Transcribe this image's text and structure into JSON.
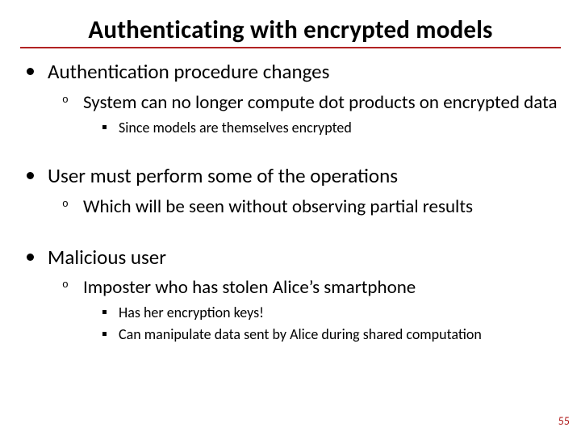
{
  "title": "Authenticating with encrypted models",
  "bullets": [
    {
      "text": "Authentication procedure changes",
      "sub": [
        {
          "text": "System can no longer compute dot products on encrypted data",
          "sub": [
            {
              "text": "Since models are themselves encrypted"
            }
          ]
        }
      ]
    },
    {
      "text": "User must perform some of the operations",
      "sub": [
        {
          "text": "Which will be seen without observing partial results"
        }
      ]
    },
    {
      "text": "Malicious user",
      "sub": [
        {
          "text": "Imposter who has stolen Alice’s smartphone",
          "sub": [
            {
              "text": "Has her encryption keys!"
            },
            {
              "text": "Can manipulate data sent by Alice during shared computation"
            }
          ]
        }
      ]
    }
  ],
  "page_number": "55"
}
